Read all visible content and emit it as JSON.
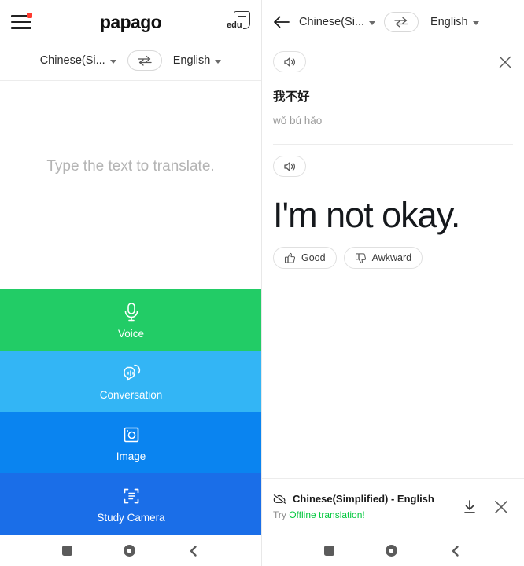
{
  "app": {
    "brand": "papago",
    "edu_badge": "edu"
  },
  "left": {
    "menu_icon": "hamburger-menu-icon",
    "source_lang": "Chinese(Si...",
    "target_lang": "English",
    "swap_icon": "swap-arrows-icon",
    "input_placeholder": "Type the text to translate.",
    "tiles": [
      {
        "label": "Voice",
        "icon": "microphone-icon",
        "color": "#22cc66"
      },
      {
        "label": "Conversation",
        "icon": "conversation-bubbles-icon",
        "color": "#33b5f5"
      },
      {
        "label": "Image",
        "icon": "camera-image-icon",
        "color": "#0a84f0"
      },
      {
        "label": "Study Camera",
        "icon": "document-scan-icon",
        "color": "#1a6ee8"
      }
    ]
  },
  "right": {
    "back_icon": "back-arrow-icon",
    "source_lang": "Chinese(Si...",
    "target_lang": "English",
    "swap_icon": "swap-arrows-icon",
    "source_speaker_icon": "speaker-icon",
    "close_icon": "close-icon",
    "source_text": "我不好",
    "pinyin": "wǒ bú hǎo",
    "result_speaker_icon": "speaker-icon",
    "result_text": "I'm not okay.",
    "feedback": [
      {
        "label": "Good",
        "icon": "thumbs-up-icon"
      },
      {
        "label": "Awkward",
        "icon": "thumbs-down-icon"
      }
    ],
    "offline": {
      "icon": "cloud-off-icon",
      "title": "Chinese(Simplified) - English",
      "prefix": "Try ",
      "link": "Offline translation!",
      "download_icon": "download-icon",
      "close_icon": "close-icon",
      "link_color": "#00c73c"
    }
  },
  "navbar": {
    "recents": "recents-square-icon",
    "home": "home-circle-icon",
    "back": "back-chevron-icon"
  }
}
